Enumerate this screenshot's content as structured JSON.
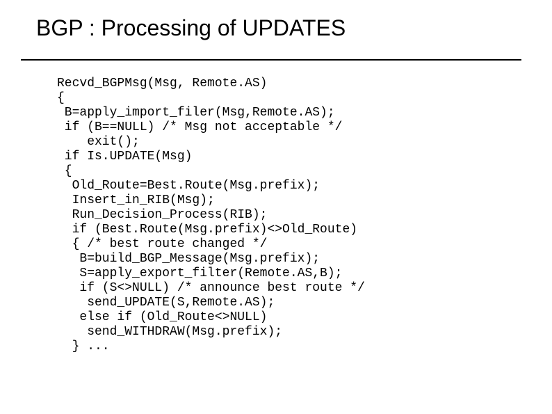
{
  "title": "BGP : Processing of UPDATES",
  "code": {
    "l1": "Recvd_BGPMsg(Msg, Remote.AS)",
    "l2": "{",
    "l3": " B=apply_import_filer(Msg,Remote.AS);",
    "l4": " if (B==NULL) /* Msg not acceptable */",
    "l5": "    exit();",
    "l6": " if Is.UPDATE(Msg)",
    "l7": " {",
    "l8": "  Old_Route=Best.Route(Msg.prefix);",
    "l9": "  Insert_in_RIB(Msg);",
    "l10": "  Run_Decision_Process(RIB);",
    "l11": "  if (Best.Route(Msg.prefix)<>Old_Route)",
    "l12": "  { /* best route changed */",
    "l13": "   B=build_BGP_Message(Msg.prefix);",
    "l14": "   S=apply_export_filter(Remote.AS,B);",
    "l15": "   if (S<>NULL) /* announce best route */",
    "l16": "    send_UPDATE(S,Remote.AS);",
    "l17": "   else if (Old_Route<>NULL)",
    "l18": "    send_WITHDRAW(Msg.prefix);",
    "l19": "  } ..."
  }
}
